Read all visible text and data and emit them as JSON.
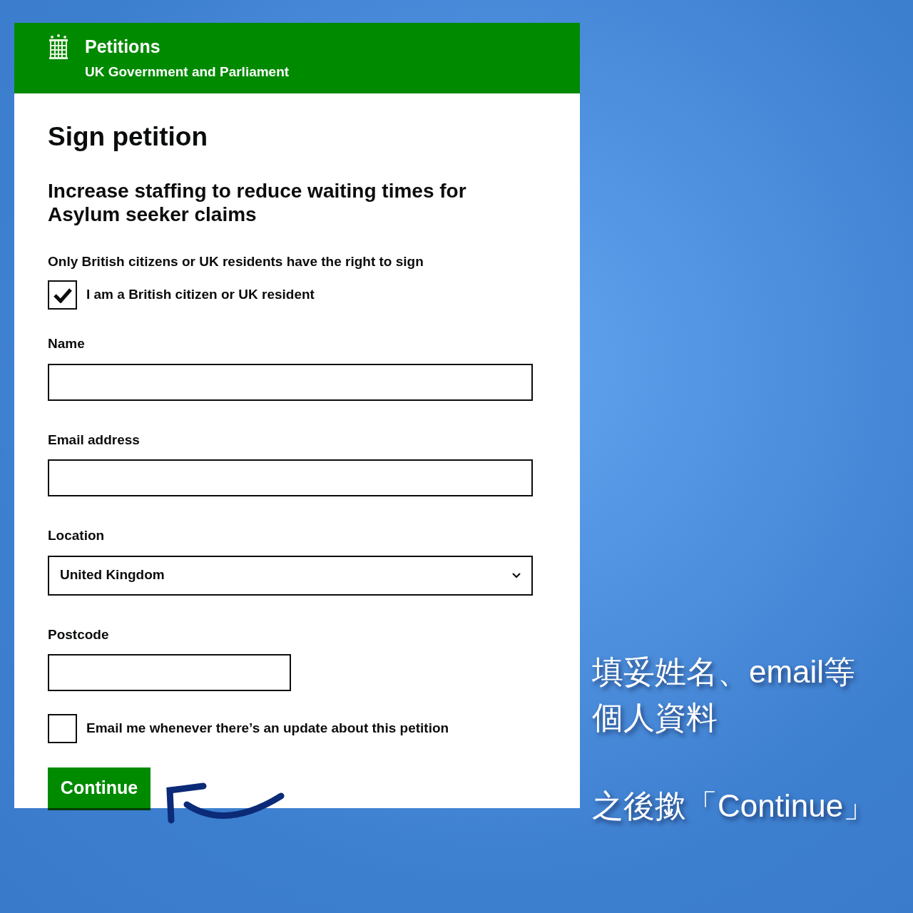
{
  "header": {
    "title": "Petitions",
    "subtitle": "UK Government and Parliament"
  },
  "heading": "Sign petition",
  "petition_title": "Increase staffing to reduce waiting times for Asylum seeker claims",
  "eligibility_note": "Only British citizens or UK residents have the right to sign",
  "eligibility_checkbox": {
    "label": "I am a British citizen or UK resident",
    "checked": true
  },
  "fields": [
    {
      "kind": "text",
      "label": "Name"
    },
    {
      "kind": "text",
      "label": "Email address"
    },
    {
      "kind": "select",
      "label": "Location",
      "value": "United Kingdom"
    },
    {
      "kind": "short",
      "label": "Postcode"
    }
  ],
  "updates_checkbox": {
    "label": "Email me whenever there’s an update about this petition",
    "checked": false
  },
  "button": "Continue",
  "annotations": [
    {
      "lines": [
        "填妥姓名、email等",
        "個人資料"
      ]
    },
    {
      "lines": [
        "之後撳「Continue」"
      ]
    }
  ]
}
